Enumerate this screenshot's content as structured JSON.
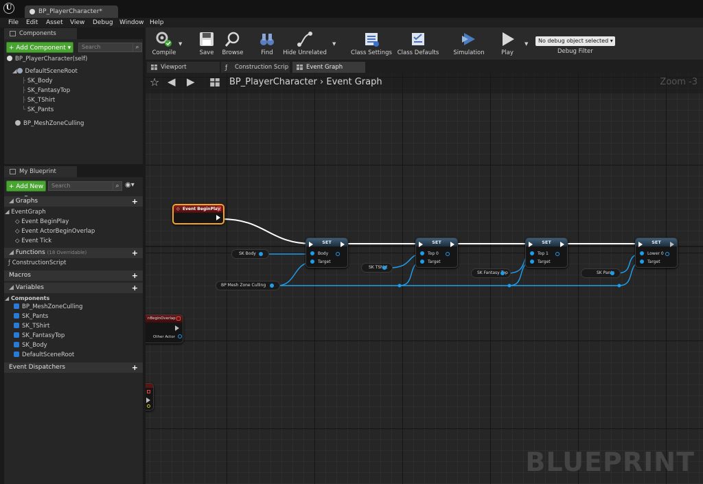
{
  "window": {
    "tab_title": "BP_PlayerCharacter*"
  },
  "menu": [
    "File",
    "Edit",
    "Asset",
    "View",
    "Debug",
    "Window",
    "Help"
  ],
  "components_panel": {
    "title": "Components",
    "add_button": "+ Add Component ▾",
    "search_placeholder": "Search",
    "self_item": "BP_PlayerCharacter(self)",
    "tree": [
      "DefaultSceneRoot",
      "SK_Body",
      "SK_FantasyTop",
      "SK_TShirt",
      "SK_Pants",
      "BP_MeshZoneCulling"
    ]
  },
  "my_blueprint_panel": {
    "title": "My Blueprint",
    "add_button": "+ Add New ▾",
    "search_placeholder": "Search",
    "sections": {
      "graphs": "Graphs",
      "event_graph": "EventGraph",
      "events": [
        "Event BeginPlay",
        "Event ActorBeginOverlap",
        "Event Tick"
      ],
      "functions": "Functions",
      "functions_count": "(18 Overridable)",
      "construction_script": "ConstructionScript",
      "macros": "Macros",
      "variables": "Variables",
      "components_cat": "Components",
      "variables_list": [
        "BP_MeshZoneCulling",
        "SK_Pants",
        "SK_TShirt",
        "SK_FantasyTop",
        "SK_Body",
        "DefaultSceneRoot"
      ],
      "event_dispatchers": "Event Dispatchers"
    }
  },
  "toolbar": {
    "compile": "Compile",
    "save": "Save",
    "browse": "Browse",
    "find": "Find",
    "hide_unrelated": "Hide Unrelated",
    "class_settings": "Class Settings",
    "class_defaults": "Class Defaults",
    "simulation": "Simulation",
    "play": "Play",
    "debug_object": "No debug object selected ▾",
    "debug_filter": "Debug Filter"
  },
  "graph_tabs": [
    "Viewport",
    "Construction Scrip",
    "Event Graph"
  ],
  "graph": {
    "breadcrumb": "BP_PlayerCharacter › Event Graph",
    "zoom": "Zoom -3",
    "watermark": "BLUEPRINT",
    "event_begin_play": "Event BeginPlay",
    "set_title": "SET",
    "set_nodes": [
      {
        "var": "Body",
        "getter": "SK Body"
      },
      {
        "var": "Top 0",
        "getter": "SK TShirt"
      },
      {
        "var": "Top 1",
        "getter": "SK Fantasy Top"
      },
      {
        "var": "Lower 0",
        "getter": "SK Pants"
      }
    ],
    "target_label": "Target",
    "culling_getter": "BP Mesh Zone Culling",
    "overlap_node": "nBeginOverlap",
    "other_actor": "Other Actor"
  }
}
